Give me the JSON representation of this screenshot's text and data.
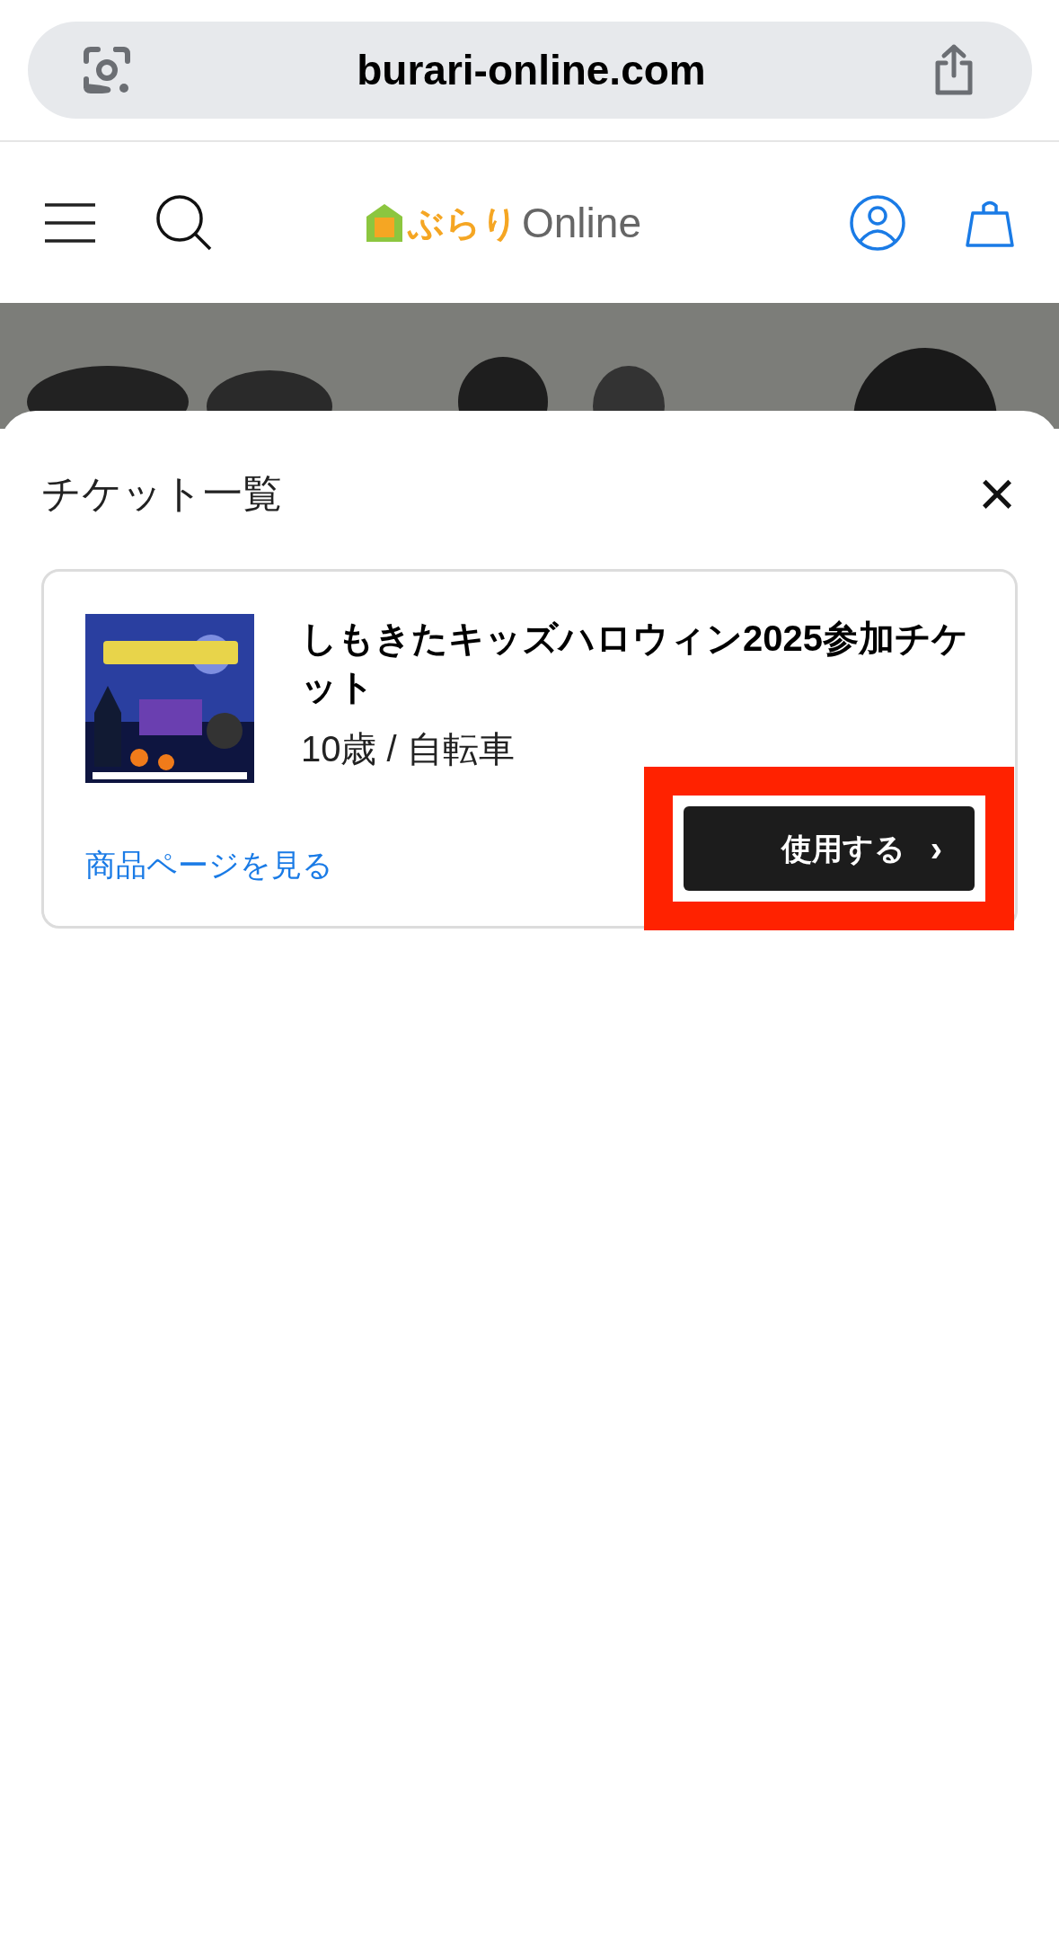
{
  "browser": {
    "address": "burari-online.com"
  },
  "header": {
    "logo": {
      "mark": "ぶらり",
      "word": "Online"
    }
  },
  "sheet": {
    "title": "チケット一覧",
    "close": "×",
    "tickets": [
      {
        "title": "しもきたキッズハロウィン2025参加チケット",
        "variant": "10歳 / 自転車",
        "link": "商品ページを見る",
        "button": {
          "label": "使用する",
          "chevron": "›",
          "highlighted": true
        }
      }
    ]
  }
}
